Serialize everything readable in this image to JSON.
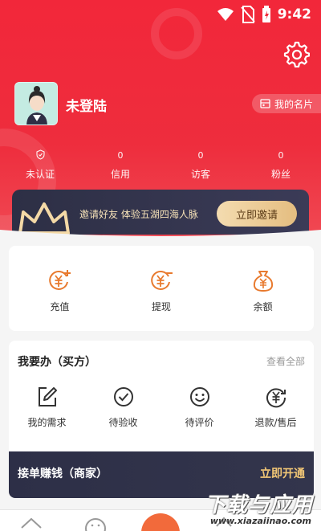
{
  "status_bar": {
    "time": "9:42"
  },
  "profile": {
    "username": "未登陆",
    "card_button": "我的名片"
  },
  "stats": [
    {
      "value": "",
      "label": "未认证"
    },
    {
      "value": "0",
      "label": "信用"
    },
    {
      "value": "0",
      "label": "访客"
    },
    {
      "value": "0",
      "label": "粉丝"
    }
  ],
  "invite": {
    "text": "邀请好友 体验五湖四海人脉",
    "button": "立即邀请"
  },
  "wallet": [
    {
      "label": "充值",
      "icon": "recharge-icon"
    },
    {
      "label": "提现",
      "icon": "withdraw-icon"
    },
    {
      "label": "余额",
      "icon": "balance-icon"
    }
  ],
  "orders": {
    "title": "我要办（买方）",
    "view_all": "查看全部",
    "items": [
      {
        "label": "我的需求",
        "icon": "edit-icon"
      },
      {
        "label": "待验收",
        "icon": "check-circle-icon"
      },
      {
        "label": "待评价",
        "icon": "smile-icon"
      },
      {
        "label": "退款/售后",
        "icon": "refund-icon"
      }
    ]
  },
  "merchant": {
    "title": "接单赚钱（商家）",
    "action": "立即开通"
  },
  "watermark": {
    "big": "下载与应用",
    "small": "www.xiazaiinao.com"
  },
  "colors": {
    "primary_red": "#ef2a3b",
    "gold": "#f2c776",
    "dark_navy": "#2d2f47",
    "orange": "#e87a2e"
  }
}
